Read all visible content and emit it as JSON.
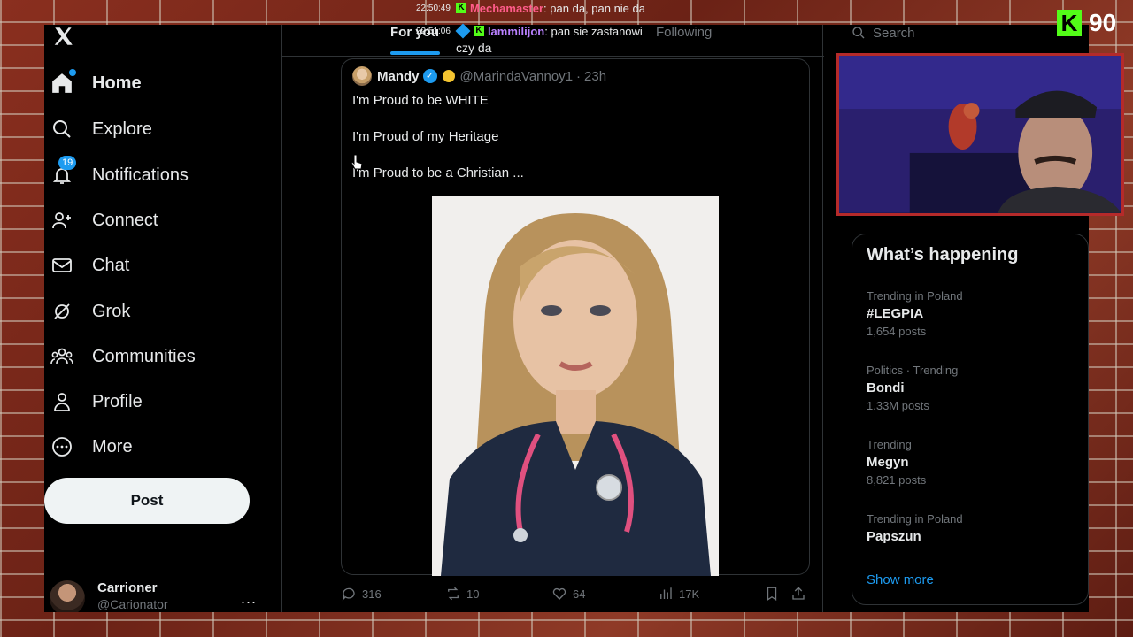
{
  "nav": {
    "items": [
      {
        "label": "Home",
        "icon": "home-icon",
        "active": true
      },
      {
        "label": "Explore",
        "icon": "search-icon"
      },
      {
        "label": "Notifications",
        "icon": "bell-icon",
        "badge": "19"
      },
      {
        "label": "Connect",
        "icon": "person-add-icon"
      },
      {
        "label": "Chat",
        "icon": "envelope-icon"
      },
      {
        "label": "Grok",
        "icon": "grok-icon"
      },
      {
        "label": "Communities",
        "icon": "people-icon"
      },
      {
        "label": "Profile",
        "icon": "person-icon"
      },
      {
        "label": "More",
        "icon": "more-circle-icon"
      }
    ],
    "post_label": "Post",
    "account": {
      "name": "Carrioner",
      "handle": "@Carionator",
      "more": "..."
    }
  },
  "tabs": {
    "for_you": "For you",
    "following": "Following"
  },
  "tweet": {
    "author": "Mandy",
    "handle": "@MarindaVannoy1",
    "separator": "·",
    "time": "23h",
    "lines": [
      "I'm Proud to be WHITE",
      "I'm Proud of my Heritage",
      "I'm Proud to be a Christian ..."
    ],
    "stats": {
      "replies": "316",
      "reposts": "10",
      "likes": "64",
      "views": "17K"
    }
  },
  "search": {
    "placeholder": "Search"
  },
  "trends": {
    "title": "What’s happening",
    "items": [
      {
        "meta": "Trending in Poland",
        "name": "#LEGPIA",
        "count": "1,654 posts"
      },
      {
        "meta": "Politics · Trending",
        "name": "Bondi",
        "count": "1.33M posts"
      },
      {
        "meta": "Trending",
        "name": "Megyn",
        "count": "8,821 posts"
      },
      {
        "meta": "Trending in Poland",
        "name": "Papszun",
        "count": ""
      }
    ],
    "show_more": "Show more"
  },
  "stream_overlay": {
    "chat": [
      {
        "time": "22:50:49",
        "user": "Mechamaster",
        "message": "pan da, pan nie da"
      },
      {
        "time": "22:51:06",
        "user": "lammilijon",
        "message": "pan sie zastanowi"
      }
    ],
    "chat_continuation": "czy da",
    "viewer_count": "90",
    "kick_logo": "K"
  },
  "colors": {
    "accent": "#1d9bf0",
    "background": "#000000",
    "kick_green": "#53fc18",
    "webcam_border": "#b52a2a"
  }
}
